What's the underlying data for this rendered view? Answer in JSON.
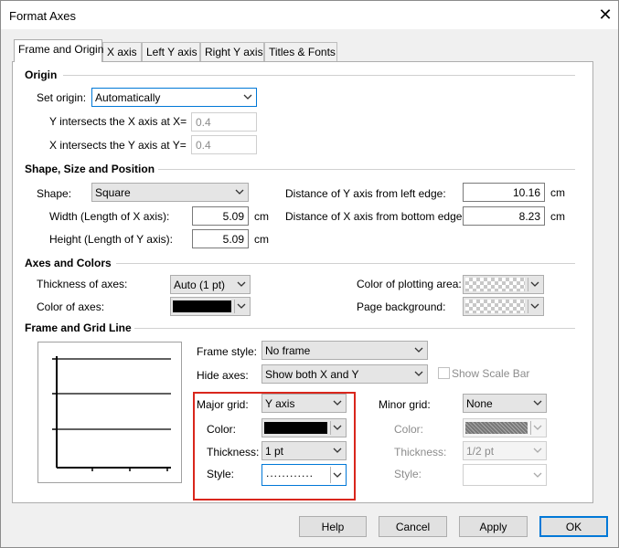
{
  "window": {
    "title": "Format Axes"
  },
  "tabs": [
    {
      "label": "Frame and Origin"
    },
    {
      "label": "X axis"
    },
    {
      "label": "Left Y axis"
    },
    {
      "label": "Right Y axis"
    },
    {
      "label": "Titles & Fonts"
    }
  ],
  "origin": {
    "heading": "Origin",
    "set_origin_label": "Set origin:",
    "set_origin_value": "Automatically",
    "y_intersect_label": "Y intersects the X axis at X=",
    "y_intersect_value": "0.4",
    "x_intersect_label": "X intersects the Y axis at Y=",
    "x_intersect_value": "0.4"
  },
  "shape": {
    "heading": "Shape, Size and Position",
    "shape_label": "Shape:",
    "shape_value": "Square",
    "width_label": "Width (Length of X axis):",
    "width_value": "5.09",
    "height_label": "Height (Length of Y axis):",
    "height_value": "5.09",
    "dist_y_label": "Distance of Y axis from left edge:",
    "dist_y_value": "10.16",
    "dist_x_label": "Distance of X axis from bottom edge:",
    "dist_x_value": "8.23",
    "unit": "cm"
  },
  "axes_colors": {
    "heading": "Axes and Colors",
    "thickness_label": "Thickness of axes:",
    "thickness_value": "Auto (1 pt)",
    "color_label": "Color of axes:",
    "plotting_area_label": "Color of plotting area:",
    "page_bg_label": "Page background:"
  },
  "frame_grid": {
    "heading": "Frame and Grid Line",
    "frame_style_label": "Frame style:",
    "frame_style_value": "No frame",
    "hide_axes_label": "Hide axes:",
    "hide_axes_value": "Show both X and Y",
    "show_scale_bar_label": "Show Scale Bar",
    "major": {
      "grid_label": "Major grid:",
      "grid_value": "Y axis",
      "color_label": "Color:",
      "thickness_label": "Thickness:",
      "thickness_value": "1 pt",
      "style_label": "Style:",
      "style_value": "............"
    },
    "minor": {
      "grid_label": "Minor grid:",
      "grid_value": "None",
      "color_label": "Color:",
      "thickness_label": "Thickness:",
      "thickness_value": "1/2 pt",
      "style_label": "Style:"
    }
  },
  "buttons": {
    "help": "Help",
    "cancel": "Cancel",
    "apply": "Apply",
    "ok": "OK"
  },
  "colors": {
    "accent": "#0078d7",
    "highlight_box": "#d9261c",
    "axes_color": "#000000",
    "major_grid_color": "#000000"
  }
}
